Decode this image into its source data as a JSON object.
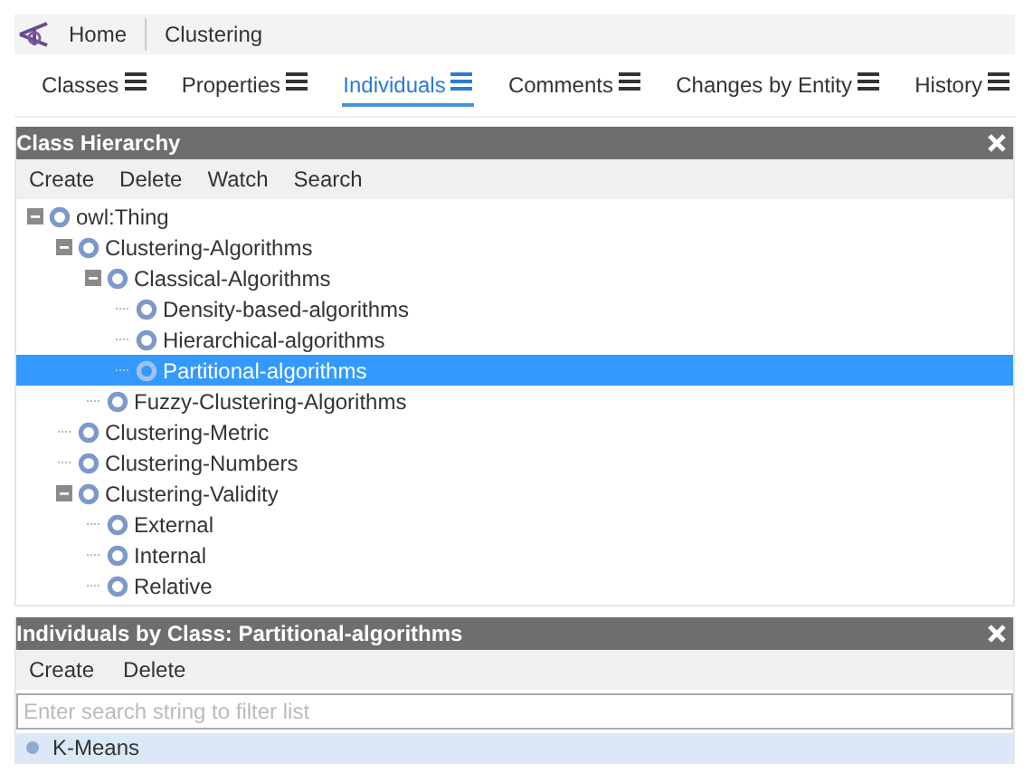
{
  "breadcrumb": [
    {
      "label": "Home"
    },
    {
      "label": "Clustering"
    }
  ],
  "tabs": [
    {
      "label": "Classes",
      "selected": false
    },
    {
      "label": "Properties",
      "selected": false
    },
    {
      "label": "Individuals",
      "selected": true
    },
    {
      "label": "Comments",
      "selected": false
    },
    {
      "label": "Changes by Entity",
      "selected": false
    },
    {
      "label": "History",
      "selected": false
    }
  ],
  "class_hierarchy": {
    "title": "Class Hierarchy",
    "actions": [
      "Create",
      "Delete",
      "Watch",
      "Search"
    ],
    "tree": [
      {
        "label": "owl:Thing",
        "expanded": true,
        "selected": false,
        "children": [
          {
            "label": "Clustering-Algorithms",
            "expanded": true,
            "selected": false,
            "children": [
              {
                "label": "Classical-Algorithms",
                "expanded": true,
                "selected": false,
                "children": [
                  {
                    "label": "Density-based-algorithms",
                    "selected": false
                  },
                  {
                    "label": "Hierarchical-algorithms",
                    "selected": false
                  },
                  {
                    "label": "Partitional-algorithms",
                    "selected": true
                  }
                ]
              },
              {
                "label": "Fuzzy-Clustering-Algorithms",
                "selected": false
              }
            ]
          },
          {
            "label": "Clustering-Metric",
            "selected": false
          },
          {
            "label": "Clustering-Numbers",
            "selected": false
          },
          {
            "label": "Clustering-Validity",
            "expanded": true,
            "selected": false,
            "children": [
              {
                "label": "External",
                "selected": false
              },
              {
                "label": "Internal",
                "selected": false
              },
              {
                "label": "Relative",
                "selected": false
              }
            ]
          }
        ]
      }
    ]
  },
  "individuals": {
    "title": "Individuals by Class: Partitional-algorithms",
    "actions": [
      "Create",
      "Delete"
    ],
    "search": {
      "placeholder": "Enter search string to filter list"
    },
    "items": [
      {
        "label": "K-Means",
        "selected": true
      }
    ]
  }
}
